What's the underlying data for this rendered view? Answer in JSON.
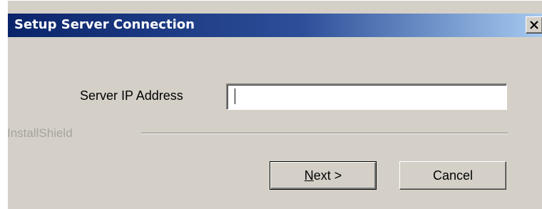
{
  "window": {
    "title": "Setup Server Connection",
    "close_icon": "close-icon"
  },
  "form": {
    "server_ip_label": "Server IP Address",
    "server_ip_value": "",
    "server_ip_placeholder": ""
  },
  "footer": {
    "brand": "InstallShield"
  },
  "buttons": {
    "next_mnemonic": "N",
    "next_rest": "ext >",
    "cancel_label": "Cancel"
  },
  "colors": {
    "titlebar_start": "#0a246a",
    "titlebar_end": "#a6caf0",
    "face": "#d4d0c8"
  }
}
